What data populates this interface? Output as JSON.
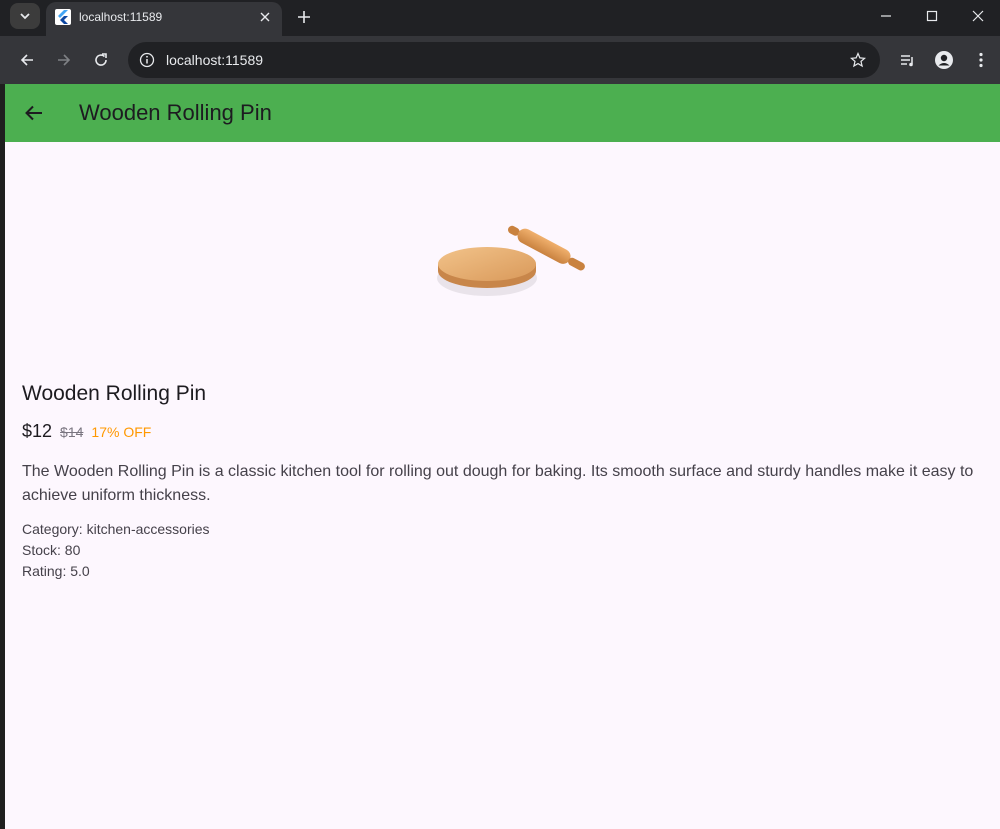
{
  "browser": {
    "tab_title": "localhost:11589",
    "url": "localhost:11589"
  },
  "colors": {
    "app_bar": "#4caf50",
    "page_background": "#fdf7fe",
    "discount": "#ff9800"
  },
  "app_bar": {
    "title": "Wooden Rolling Pin",
    "back_icon": "arrow-back-icon"
  },
  "product": {
    "image": "rolling-pin-with-board",
    "name": "Wooden Rolling Pin",
    "price": "$12",
    "old_price": "$14",
    "discount": "17% OFF",
    "description": "The Wooden Rolling Pin is a classic kitchen tool for rolling out dough for baking. Its smooth surface and sturdy handles make it easy to achieve uniform thickness.",
    "category_line": "Category: kitchen-accessories",
    "stock_line": "Stock: 80",
    "rating_line": "Rating: 5.0"
  }
}
